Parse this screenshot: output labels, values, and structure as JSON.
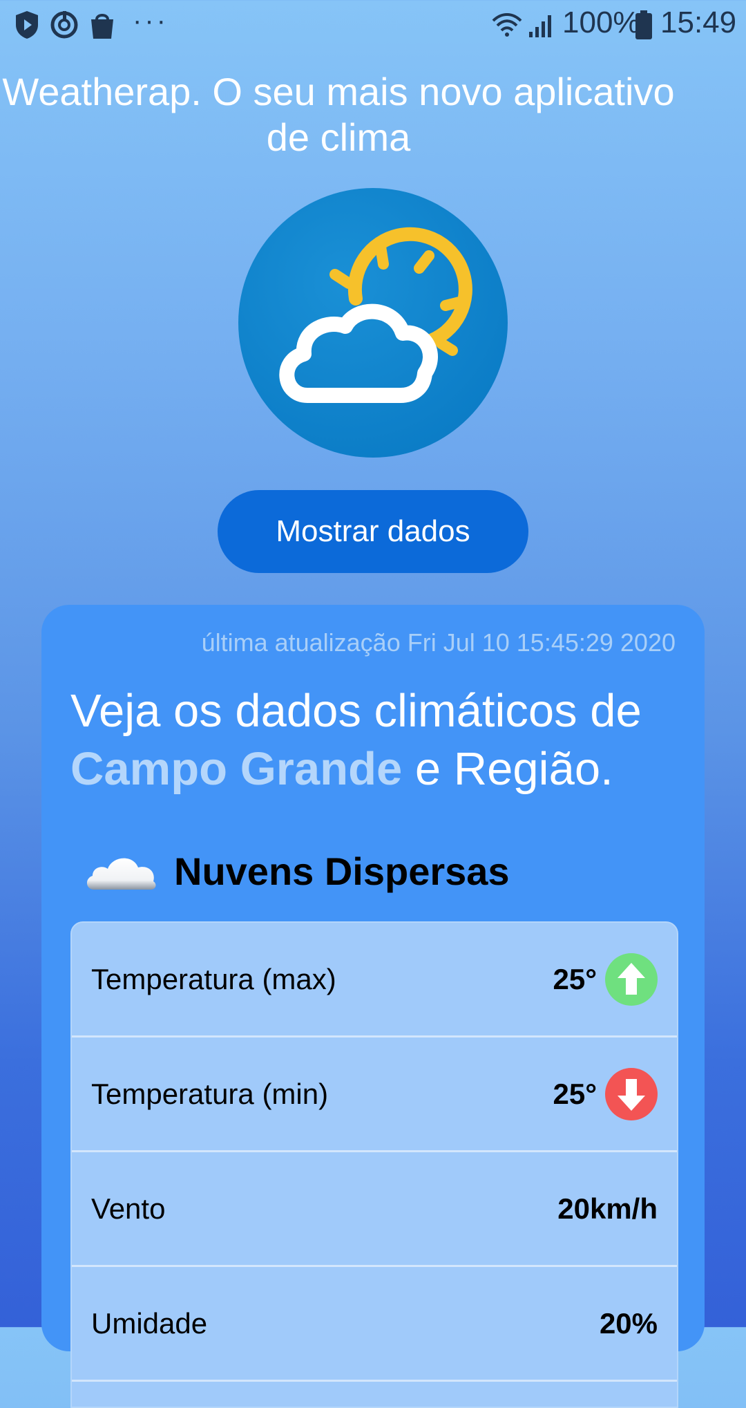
{
  "status_bar": {
    "battery_percent": "100%",
    "time": "15:49",
    "left_icons": [
      "shield-play-icon",
      "sync-icon",
      "shopping-bag-icon",
      "more-dots-icon"
    ],
    "right_icons": [
      "wifi-icon",
      "signal-icon",
      "battery-icon"
    ]
  },
  "header": {
    "headline": "Weatherap. O seu mais novo aplicativo de clima"
  },
  "logo": {
    "icon": "partly-cloudy-icon",
    "bg_color": "#0f88d0",
    "sun_color": "#f6c12b"
  },
  "actions": {
    "show_data_label": "Mostrar dados"
  },
  "card": {
    "updated_prefix": "última atualização",
    "updated_value": "Fri Jul 10 15:45:29 2020",
    "title_prefix": "Veja os dados climáticos de",
    "city": "Campo Grande",
    "title_suffix": "e Região.",
    "condition": {
      "icon": "cloud-icon",
      "label": "Nuvens Dispersas"
    },
    "rows": [
      {
        "label": "Temperatura (max)",
        "value": "25°",
        "indicator": "arrow-up-icon",
        "indicator_color": "#6fe07f"
      },
      {
        "label": "Temperatura (min)",
        "value": "25°",
        "indicator": "arrow-down-icon",
        "indicator_color": "#f35454"
      },
      {
        "label": "Vento",
        "value": "20km/h"
      },
      {
        "label": "Umidade",
        "value": "20%"
      }
    ]
  }
}
